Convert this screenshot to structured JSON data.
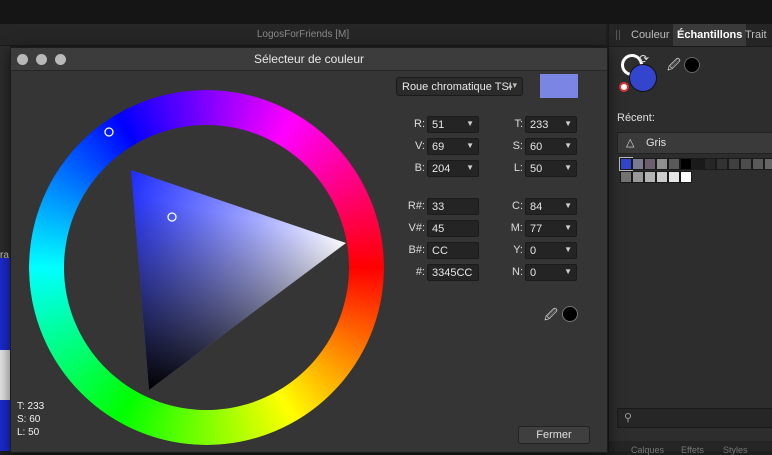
{
  "document": {
    "title": "LogosForFriends [M]",
    "side_text": "ra"
  },
  "dialog": {
    "title": "Sélecteur de couleur",
    "mode": "Roue chromatique TSI",
    "preview_color": "#7b86e4",
    "current_color": "#3345cc",
    "hsl": {
      "t": "T: 233",
      "s": "S: 60",
      "l": "L: 50"
    },
    "rgb": [
      {
        "label": "R:",
        "value": "51"
      },
      {
        "label": "V:",
        "value": "69"
      },
      {
        "label": "B:",
        "value": "204"
      }
    ],
    "tsl": [
      {
        "label": "T:",
        "value": "233"
      },
      {
        "label": "S:",
        "value": "60"
      },
      {
        "label": "L:",
        "value": "50"
      }
    ],
    "hex": [
      {
        "label": "R#:",
        "value": "33"
      },
      {
        "label": "V#:",
        "value": "45"
      },
      {
        "label": "B#:",
        "value": "CC"
      },
      {
        "label": "#:",
        "value": "3345CC"
      }
    ],
    "cmjn": [
      {
        "label": "C:",
        "value": "84"
      },
      {
        "label": "M:",
        "value": "77"
      },
      {
        "label": "Y:",
        "value": "0"
      },
      {
        "label": "N:",
        "value": "0"
      }
    ],
    "close_label": "Fermer"
  },
  "panel": {
    "tabs": [
      "Couleur",
      "Échantillons",
      "Trait"
    ],
    "active_tab": "Échantillons",
    "fill_color": "#3345cc",
    "recent_label": "Récent:",
    "palette_name": "Gris",
    "swatch_row1": [
      "#3345cc",
      "#7b7b8f",
      "#6b5f6b",
      "#8f8f8f",
      "#5a5a5a",
      "#000000",
      "#1a1a1a",
      "#262626",
      "#333333",
      "#404040",
      "#4d4d4d",
      "#595959",
      "#666666"
    ],
    "swatch_row2": [
      "#737373",
      "#999999",
      "#b3b3b3",
      "#cccccc",
      "#e6e6e6",
      "#ffffff"
    ],
    "bottom_tabs": [
      "Calques",
      "Effets",
      "Styles"
    ]
  }
}
